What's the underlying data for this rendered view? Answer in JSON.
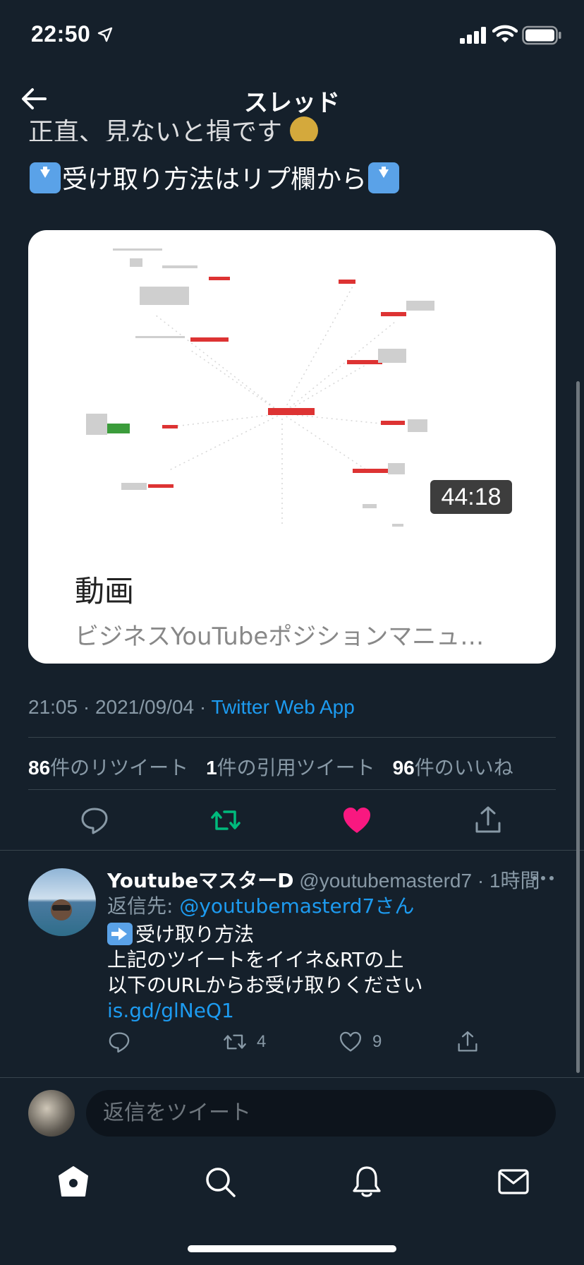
{
  "status_bar": {
    "time": "22:50"
  },
  "nav": {
    "title": "スレッド"
  },
  "tweet": {
    "line1": "正直、見ないと損です",
    "line2": "受け取り方法はリプ欄から"
  },
  "video_card": {
    "duration": "44:18",
    "title": "動画",
    "description": "ビジネスYouTubeポジションマニュ…"
  },
  "meta": {
    "time_date": "21:05 · 2021/09/04 · ",
    "source": "Twitter Web App"
  },
  "stats": {
    "retweets_num": "86",
    "retweets_label": "件のリツイート",
    "quotes_num": "1",
    "quotes_label": "件の引用ツイート",
    "likes_num": "96",
    "likes_label": "件のいいね"
  },
  "reply": {
    "name": "YoutubeマスターD",
    "handle": " @youtubemasterd7 · 1時間",
    "reply_to_prefix": "返信先: ",
    "reply_to_mention": "@youtubemasterd7さん",
    "body_line1": "受け取り方法",
    "body_line2": "上記のツイートをイイネ&RTの上",
    "body_line3": "以下のURLからお受け取りください",
    "link": "is.gd/glNeQ1",
    "retweet_count": "4",
    "like_count": "9"
  },
  "composer": {
    "placeholder": "返信をツイート"
  },
  "colors": {
    "background": "#15202b",
    "accent": "#1d9bf0",
    "like": "#f91880",
    "retweet": "#00ba7c",
    "muted": "#8899a6"
  },
  "icons": {
    "status": [
      "location-arrow-icon",
      "signal-icon",
      "wifi-icon",
      "battery-icon"
    ],
    "nav": [
      "back-arrow-icon"
    ],
    "actions": [
      "reply-icon",
      "retweet-icon",
      "like-icon",
      "share-icon"
    ],
    "tabs": [
      "home-icon",
      "search-icon",
      "notifications-icon",
      "messages-icon"
    ]
  }
}
